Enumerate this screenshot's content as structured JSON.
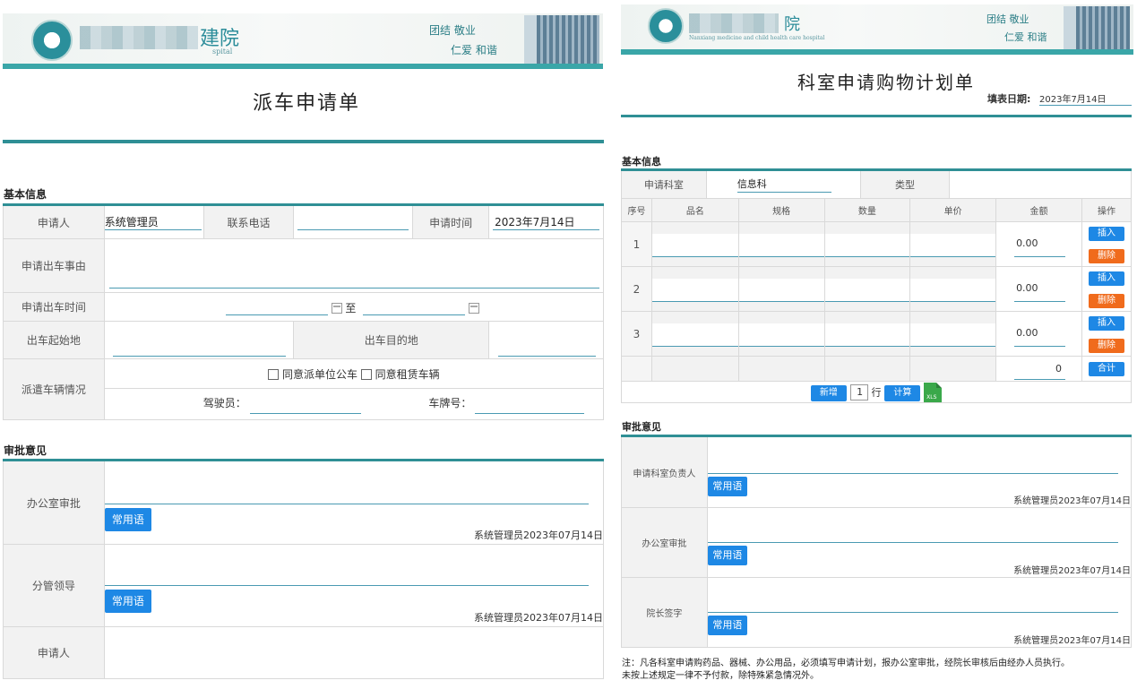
{
  "left_form": {
    "header": {
      "hosp_char": "建院",
      "sub_text": "spital",
      "motto_line1": "团结  敬业",
      "motto_line2": "仁爱  和谐"
    },
    "title": "派车申请单",
    "basic_info": {
      "section_label": "基本信息",
      "applicant_label": "申请人",
      "applicant_value": "系统管理员",
      "phone_label": "联系电话",
      "phone_value": "",
      "apply_time_label": "申请时间",
      "apply_time_value": "2023年7月14日",
      "reason_label": "申请出车事由",
      "depart_time_label": "申请出车时间",
      "to_label": "至",
      "origin_label": "出车起始地",
      "destination_label": "出车目的地",
      "dispatch_label": "派遣车辆情况",
      "option_official": "同意派单位公车",
      "option_rental": "同意租赁车辆",
      "driver_label": "驾驶员：",
      "plate_label": "车牌号："
    },
    "approval": {
      "section_label": "审批意见",
      "office_label": "办公室审批",
      "leader_label": "分管领导",
      "applicant_label": "申请人",
      "common_phrase_button": "常用语",
      "stamp": "系统管理员2023年07月14日"
    }
  },
  "right_form": {
    "header": {
      "hosp_char": "院",
      "sub_text": "Nanxiang medicine and child health care hospital",
      "motto_line1": "团结  敬业",
      "motto_line2": "仁爱  和谐"
    },
    "title": "科室申请购物计划单",
    "fill_date_label": "填表日期:",
    "fill_date_value": "2023年7月14日",
    "basic_info": {
      "section_label": "基本信息",
      "dept_label": "申请科室",
      "dept_value": "信息科",
      "type_label": "类型",
      "type_value": ""
    },
    "items_table": {
      "headers": [
        "序号",
        "品名",
        "规格",
        "数量",
        "单价",
        "金额",
        "操作"
      ],
      "rows": [
        {
          "no": "1",
          "amount": "0.00"
        },
        {
          "no": "2",
          "amount": "0.00"
        },
        {
          "no": "3",
          "amount": "0.00"
        }
      ],
      "insert_button": "插入",
      "delete_button": "删除",
      "total_value": "0",
      "total_button": "合计",
      "add_button": "新增",
      "add_count": "1",
      "row_unit": "行",
      "calc_button": "计算"
    },
    "approval": {
      "section_label": "审批意见",
      "dept_head_label": "申请科室负责人",
      "office_label": "办公室审批",
      "president_label": "院长签字",
      "common_phrase_button": "常用语",
      "stamp": "系统管理员2023年07月14日"
    },
    "note_line1": "注：凡各科室申请购药品、器械、办公用品，必须填写申请计划，报办公室审批，经院长审核后由经办人员执行。",
    "note_line2": "未按上述规定一律不予付款，除特殊紧急情况外。"
  },
  "colors": {
    "teal": "#2f8f95",
    "button_blue": "#1e88e5",
    "button_orange": "#f06b1c",
    "label_bg": "#f2f2f2"
  }
}
